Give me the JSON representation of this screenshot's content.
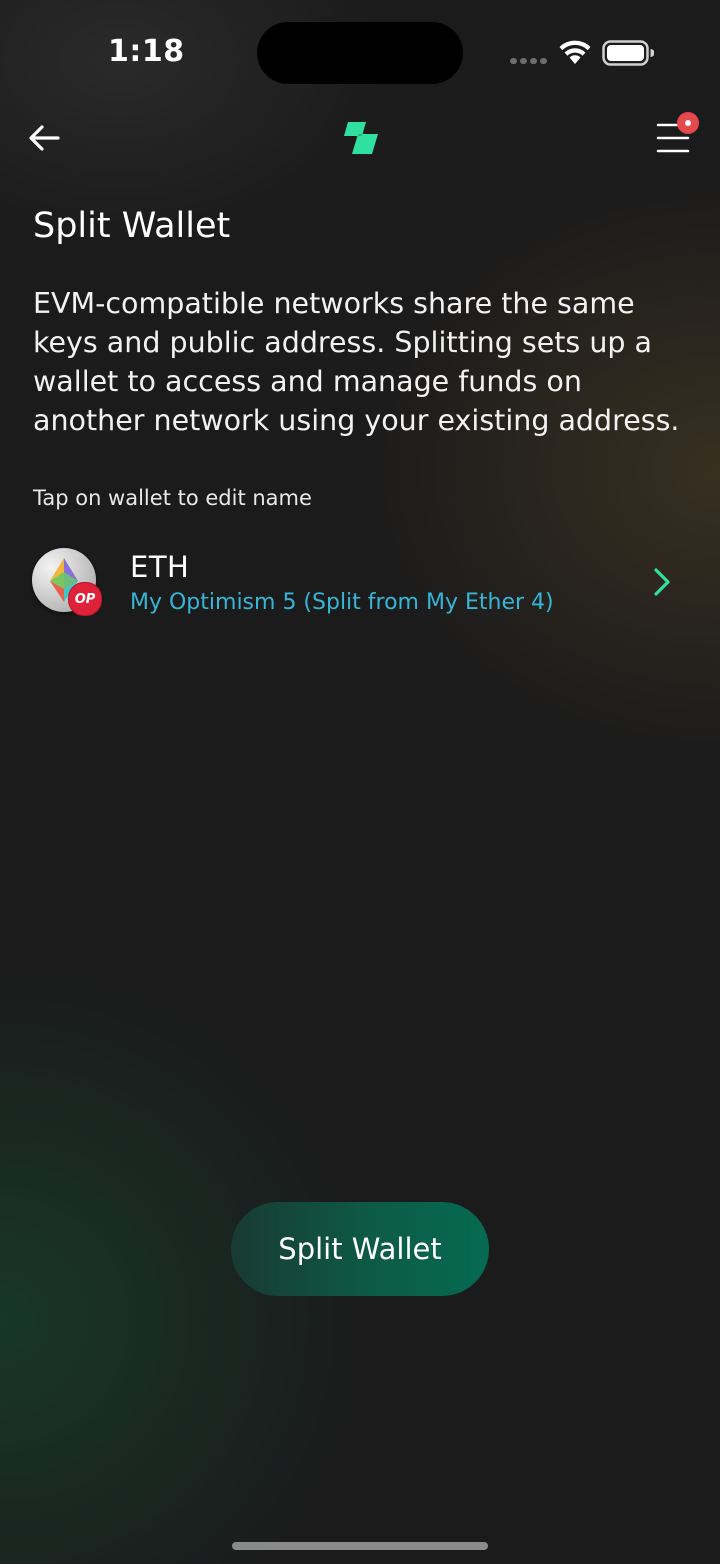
{
  "status_bar": {
    "time": "1:18"
  },
  "nav": {
    "back_icon": "arrow-left-icon",
    "logo_icon": "app-logo-icon",
    "menu_icon": "hamburger-menu-icon",
    "menu_has_notification": true
  },
  "page": {
    "title": "Split Wallet",
    "description": "EVM-compatible networks share the same keys and public address. Splitting sets up a wallet to access and manage funds on another network using your existing address.",
    "hint": "Tap on wallet to edit name"
  },
  "wallets": [
    {
      "symbol": "ETH",
      "name": "My Optimism 5 (Split from My Ether 4)",
      "badge": "OP",
      "icon": "ethereum-icon"
    }
  ],
  "actions": {
    "split_label": "Split Wallet"
  },
  "colors": {
    "accent_green": "#2fe0a0",
    "wallet_name": "#35b6d6",
    "badge_red": "#e5484d",
    "button_start": "#183a33",
    "button_end": "#056a52"
  }
}
